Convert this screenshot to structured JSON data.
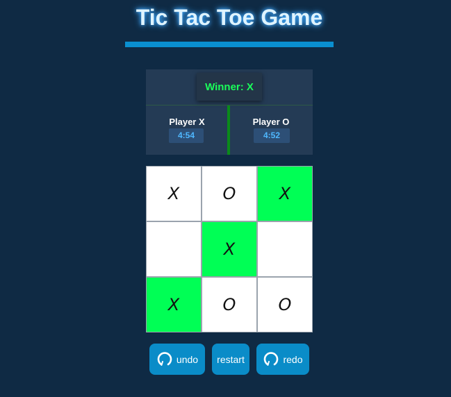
{
  "header": {
    "title": "Tic Tac Toe Game"
  },
  "status": {
    "winner_text": "Winner: X"
  },
  "players": {
    "x": {
      "name": "Player X",
      "timer": "4:54"
    },
    "o": {
      "name": "Player O",
      "timer": "4:52"
    }
  },
  "board": {
    "cells": [
      "X",
      "O",
      "X",
      "",
      "X",
      "",
      "X",
      "O",
      "O"
    ],
    "winning_cells": [
      2,
      4,
      6
    ]
  },
  "controls": {
    "undo_label": "undo",
    "restart_label": "restart",
    "redo_label": "redo",
    "undo_icon": "rotate-icon",
    "redo_icon": "rotate-icon"
  },
  "colors": {
    "background": "#0f2a44",
    "accent": "#0a8cc8",
    "win_highlight": "#00ff55",
    "winner_text": "#1aff5a"
  }
}
